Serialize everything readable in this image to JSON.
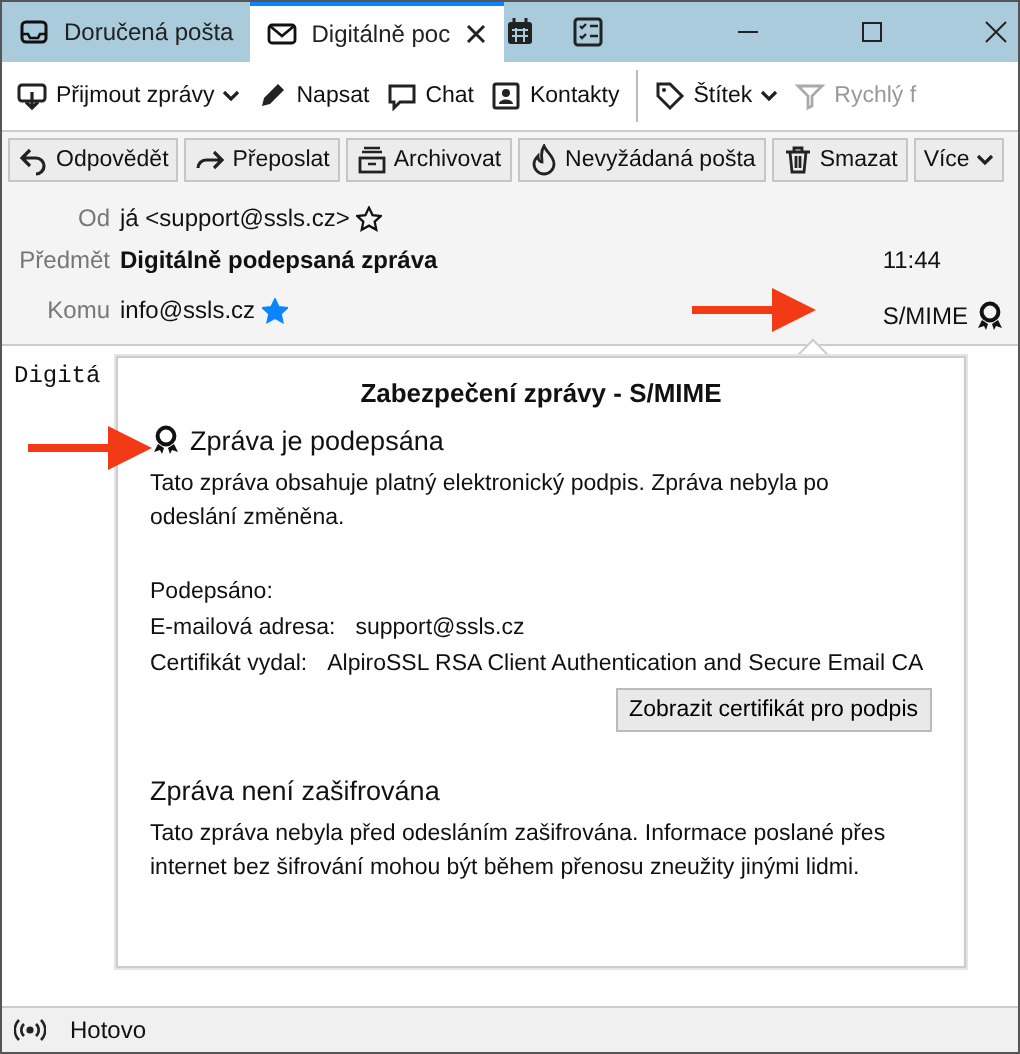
{
  "tabs": [
    {
      "label": "Doručená pošta",
      "kind": "inbox",
      "selected": false
    },
    {
      "label": "Digitálně poc",
      "kind": "mail",
      "selected": true
    }
  ],
  "toolbar": [
    {
      "label": "Přijmout zprávy",
      "dropdown": true,
      "disabled": false
    },
    {
      "label": "Napsat",
      "dropdown": false,
      "disabled": false
    },
    {
      "label": "Chat",
      "dropdown": false,
      "disabled": false
    },
    {
      "label": "Kontakty",
      "dropdown": false,
      "disabled": false
    },
    {
      "label": "Štítek",
      "dropdown": true,
      "disabled": false
    },
    {
      "label": "Rychlý f",
      "dropdown": false,
      "disabled": true
    }
  ],
  "message_actions": [
    {
      "label": "Odpovědět",
      "dropdown": false
    },
    {
      "label": "Přeposlat",
      "dropdown": false
    },
    {
      "label": "Archivovat",
      "dropdown": false
    },
    {
      "label": "Nevyžádaná pošta",
      "dropdown": false
    },
    {
      "label": "Smazat",
      "dropdown": false
    },
    {
      "label": "Více",
      "dropdown": true
    }
  ],
  "header": {
    "from_label": "Od",
    "from": "já <support@ssls.cz>",
    "from_starred": false,
    "subject_label": "Předmět",
    "subject": "Digitálně podepsaná zpráva",
    "time": "11:44",
    "to_label": "Komu",
    "to": "info@ssls.cz",
    "to_starred": true,
    "security": "S/MIME"
  },
  "body_text": "Digitá",
  "security_popup": {
    "title": "Zabezpečení zprávy - S/MIME",
    "signed_heading": "Zpráva je podepsána",
    "signed_text": "Tato zpráva obsahuje platný elektronický podpis. Zpráva nebyla po odeslání změněna.",
    "signed_by_label": "Podepsáno:",
    "details": [
      {
        "label": "E-mailová adresa:",
        "value": "support@ssls.cz"
      },
      {
        "label": "Certifikát vydal:",
        "value": "AlpiroSSL RSA Client Authentication and Secure Email CA"
      }
    ],
    "button": "Zobrazit certifikát pro podpis",
    "encryption_heading": "Zpráva není zašifrována",
    "encryption_text": "Tato zpráva nebyla před odesláním zašifrována. Informace poslané přes internet bez šifrování mohou být během přenosu zneužity jinými lidmi."
  },
  "status_bar": {
    "text": "Hotovo"
  }
}
